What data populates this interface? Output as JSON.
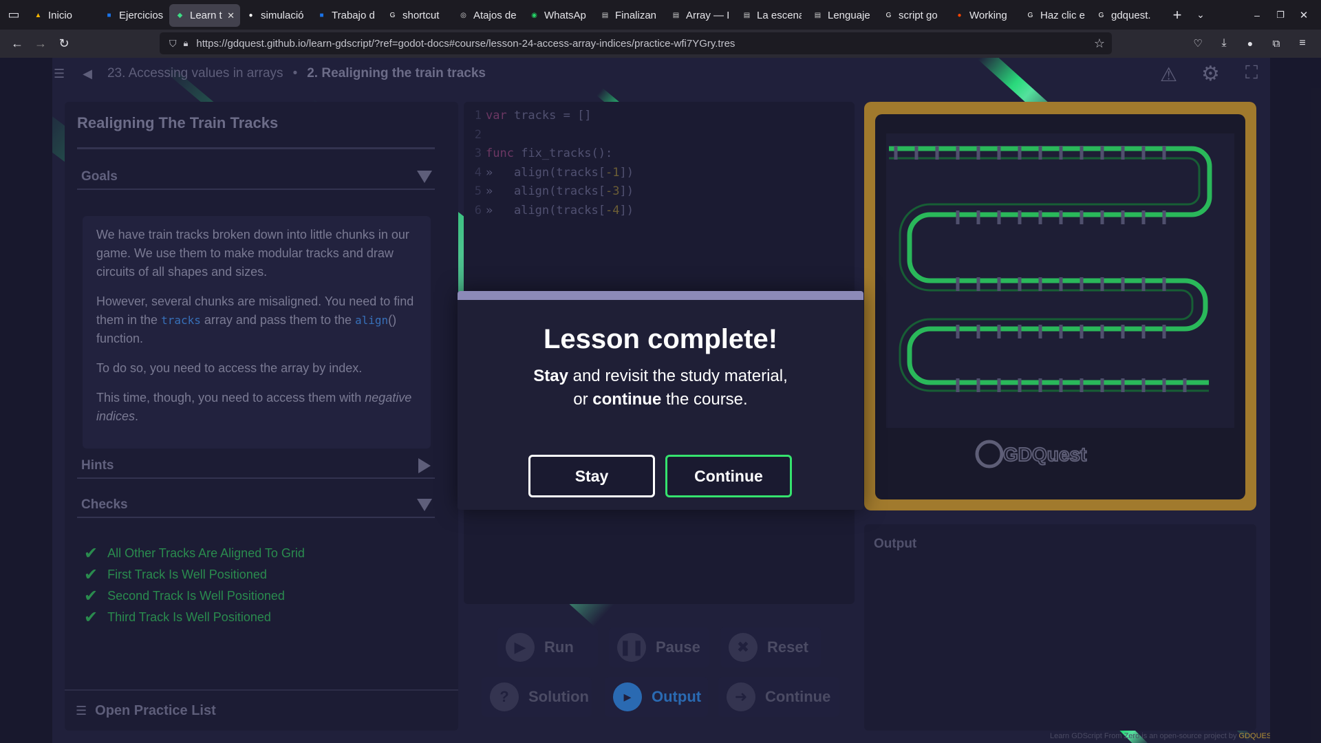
{
  "browser": {
    "tabs": [
      {
        "title": "Inicio",
        "favicon": "drive-icon",
        "color": "#f4b400",
        "active": false
      },
      {
        "title": "Ejercicios",
        "favicon": "classroom-icon",
        "color": "#1a73e8",
        "active": false
      },
      {
        "title": "Learn t",
        "favicon": "gdquest-icon",
        "color": "#3ddc84",
        "active": true
      },
      {
        "title": "simulació",
        "favicon": "github-icon",
        "color": "#ffffff",
        "active": false
      },
      {
        "title": "Trabajo d",
        "favicon": "classroom-icon",
        "color": "#1a73e8",
        "active": false
      },
      {
        "title": "shortcut",
        "favicon": "google-icon",
        "color": "#ffffff",
        "active": false
      },
      {
        "title": "Atajos de",
        "favicon": "generic-icon",
        "color": "#dddddd",
        "active": false
      },
      {
        "title": "WhatsAp",
        "favicon": "whatsapp-icon",
        "color": "#25d366",
        "active": false
      },
      {
        "title": "Finalizan",
        "favicon": "doc-icon",
        "color": "#cccccc",
        "active": false
      },
      {
        "title": "Array — I",
        "favicon": "doc-icon",
        "color": "#cccccc",
        "active": false
      },
      {
        "title": "La escena",
        "favicon": "doc-icon",
        "color": "#cccccc",
        "active": false
      },
      {
        "title": "Lenguaje",
        "favicon": "doc-icon",
        "color": "#cccccc",
        "active": false
      },
      {
        "title": "script go",
        "favicon": "google-icon",
        "color": "#ffffff",
        "active": false
      },
      {
        "title": "Working",
        "favicon": "reddit-icon",
        "color": "#ff4500",
        "active": false
      },
      {
        "title": "Haz clic e",
        "favicon": "google-icon",
        "color": "#ffffff",
        "active": false
      },
      {
        "title": "gdquest.",
        "favicon": "google-icon",
        "color": "#ffffff",
        "active": false
      }
    ],
    "url": "https://gdquest.github.io/learn-gdscript/?ref=godot-docs#course/lesson-24-access-array-indices/practice-wfi7YGry.tres"
  },
  "breadcrumb": {
    "lesson": "23. Accessing values in arrays",
    "separator": "•",
    "practice": "2. Realigning the train tracks"
  },
  "left_panel": {
    "title": "Realigning The Train Tracks",
    "goals_label": "Goals",
    "goals_p1": "We have train tracks broken down into little chunks in our game. We use them to make modular tracks and draw circuits of all shapes and sizes.",
    "goals_p2_a": "However, several chunks are misaligned. You need to find them in the ",
    "goals_p2_kw1": "tracks",
    "goals_p2_b": " array and pass them to the ",
    "goals_p2_kw2": "align",
    "goals_p2_c": "() function.",
    "goals_p3": "To do so, you need to access the array by index.",
    "goals_p4_a": "This time, though, you need to access them with ",
    "goals_p4_em": "negative indices",
    "goals_p4_b": ".",
    "hints_label": "Hints",
    "checks_label": "Checks",
    "checks": [
      "All Other Tracks Are Aligned To Grid",
      "First Track Is Well Positioned",
      "Second Track Is Well Positioned",
      "Third Track Is Well Positioned"
    ],
    "open_practice_list": "Open Practice List"
  },
  "editor": {
    "lines": [
      {
        "num": "1",
        "code": "var tracks = []"
      },
      {
        "num": "2",
        "code": ""
      },
      {
        "num": "3",
        "code": "func fix_tracks():"
      },
      {
        "num": "4",
        "code": "»   align(tracks[-1])"
      },
      {
        "num": "5",
        "code": "»   align(tracks[-3])"
      },
      {
        "num": "6",
        "code": "»   align(tracks[-4])"
      }
    ]
  },
  "game": {
    "logo_text": "GDQuest"
  },
  "output": {
    "label": "Output"
  },
  "controls": {
    "run": "Run",
    "pause": "Pause",
    "reset": "Reset",
    "solution": "Solution",
    "output": "Output",
    "continue": "Continue"
  },
  "modal": {
    "title": "Lesson complete!",
    "text_stay": "Stay",
    "text_mid": " and revisit the study material,",
    "text_or": "or ",
    "text_continue": "continue",
    "text_end": " the course.",
    "stay_button": "Stay",
    "continue_button": "Continue"
  },
  "footer": {
    "text": "Learn GDScript From Zero is an open-source project by ",
    "link": "GDQUEST.COM"
  },
  "colors": {
    "accent_green": "#35e36e",
    "check_green": "#2f9e56",
    "game_frame": "#b78a30",
    "modal_bar": "#8c8ab8"
  }
}
